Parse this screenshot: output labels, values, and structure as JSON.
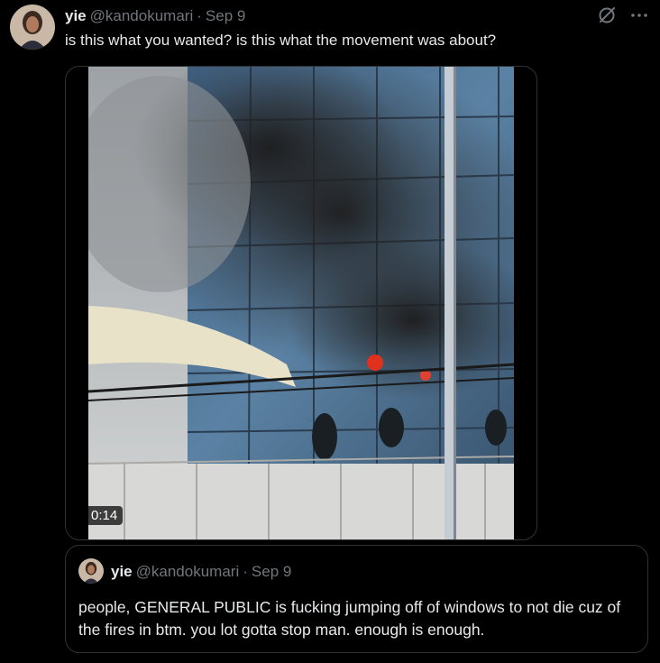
{
  "tweet": {
    "author_name": "yie",
    "author_handle": "@kandokumari",
    "separator": "·",
    "timestamp": "Sep 9",
    "text": "is this what you wanted? is this what the movement was about?",
    "media": {
      "type": "video",
      "duration": "0:14"
    },
    "icons": [
      "grok-icon",
      "more-icon"
    ]
  },
  "quoted_tweet": {
    "author_name": "yie",
    "author_handle": "@kandokumari",
    "separator": "·",
    "timestamp": "Sep 9",
    "text": "people, GENERAL PUBLIC is fucking jumping off of windows to not die cuz of the fires in btm. you lot gotta stop man. enough is enough."
  },
  "colors": {
    "background": "#000000",
    "text_primary": "#e7e9ea",
    "text_secondary": "#71767b",
    "border": "#2f3336"
  }
}
